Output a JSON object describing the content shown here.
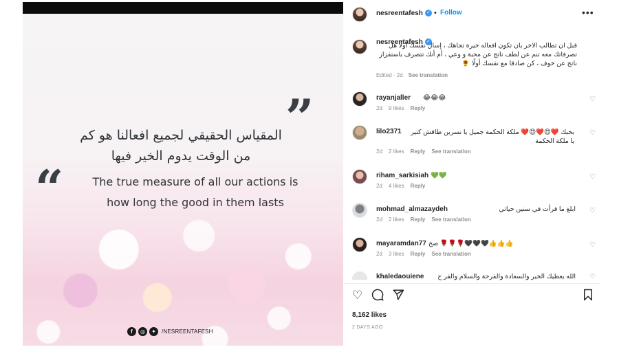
{
  "post": {
    "username": "nesreentafesh",
    "follow_label": "Follow",
    "separator": "•",
    "more_options": "•••"
  },
  "image": {
    "quote_open": "“",
    "quote_close": "”",
    "arabic_line_1": "المقياس الحقيقي لجميع افعالنا هو كم",
    "arabic_line_2": "من الوقت يدوم الخير فيها",
    "english_line_1": "The true measure of all our actions is",
    "english_line_2": "how long the good in them lasts",
    "social_handle": "/NESREENTAFESH",
    "social_icons": [
      "facebook-icon",
      "instagram-icon",
      "twitter-icon"
    ]
  },
  "caption": {
    "username": "nesreentafesh",
    "text": "قبل ان تطالب الاخر بان تكون افعاله خيرة تجاهك ، إسال نفسك أولًا هل تصرفاتك معه تنم عن لطف ناتج عن محبة و وعي ، أم أنك تتصرف باستفزاز ناتج عن خوف ، كن صادقا مع نفسك أولًا 🌻",
    "edited": "Edited · 2d",
    "see_translation": "See translation"
  },
  "comments": [
    {
      "username": "rayanjaller",
      "text": "😂😂😂",
      "time": "2d",
      "likes": "9 likes",
      "reply": "Reply",
      "translation": ""
    },
    {
      "username": "lilo2371",
      "text": "بحبك ❤️😍❤️😍❤️ ملكة الحكمة جميل يا نسرين طاقش كتير يا ملكة الحكمة",
      "time": "2d",
      "likes": "2 likes",
      "reply": "Reply",
      "translation": "See translation"
    },
    {
      "username": "riham_sarkisiah",
      "text": "💚💚",
      "time": "2d",
      "likes": "4 likes",
      "reply": "Reply",
      "translation": ""
    },
    {
      "username": "mohmad_almazaydeh",
      "text": "ابلغ ما قرأت في سنين حياتي",
      "time": "2d",
      "likes": "2 likes",
      "reply": "Reply",
      "translation": "See translation"
    },
    {
      "username": "mayaramdan77",
      "text": "صح 🌹🌹🌹🖤🖤🖤👍👍👍",
      "time": "2d",
      "likes": "3 likes",
      "reply": "Reply",
      "translation": "See translation"
    },
    {
      "username": "khaledaouiene",
      "text": "الله يعطيك الخير والسعادة والفرحة والسلام والفر ح",
      "time": "",
      "likes": "",
      "reply": "",
      "translation": ""
    }
  ],
  "actions": {
    "like_icon": "heart-outline-icon",
    "comment_icon": "comment-bubble-icon",
    "share_icon": "paper-plane-icon",
    "save_icon": "bookmark-icon"
  },
  "likes_count": "8,162 likes",
  "date": "2 DAYS AGO",
  "colors": {
    "follow": "#0095f6",
    "verified": "#3897f0",
    "muted": "#8e8e8e",
    "text": "#262626"
  }
}
